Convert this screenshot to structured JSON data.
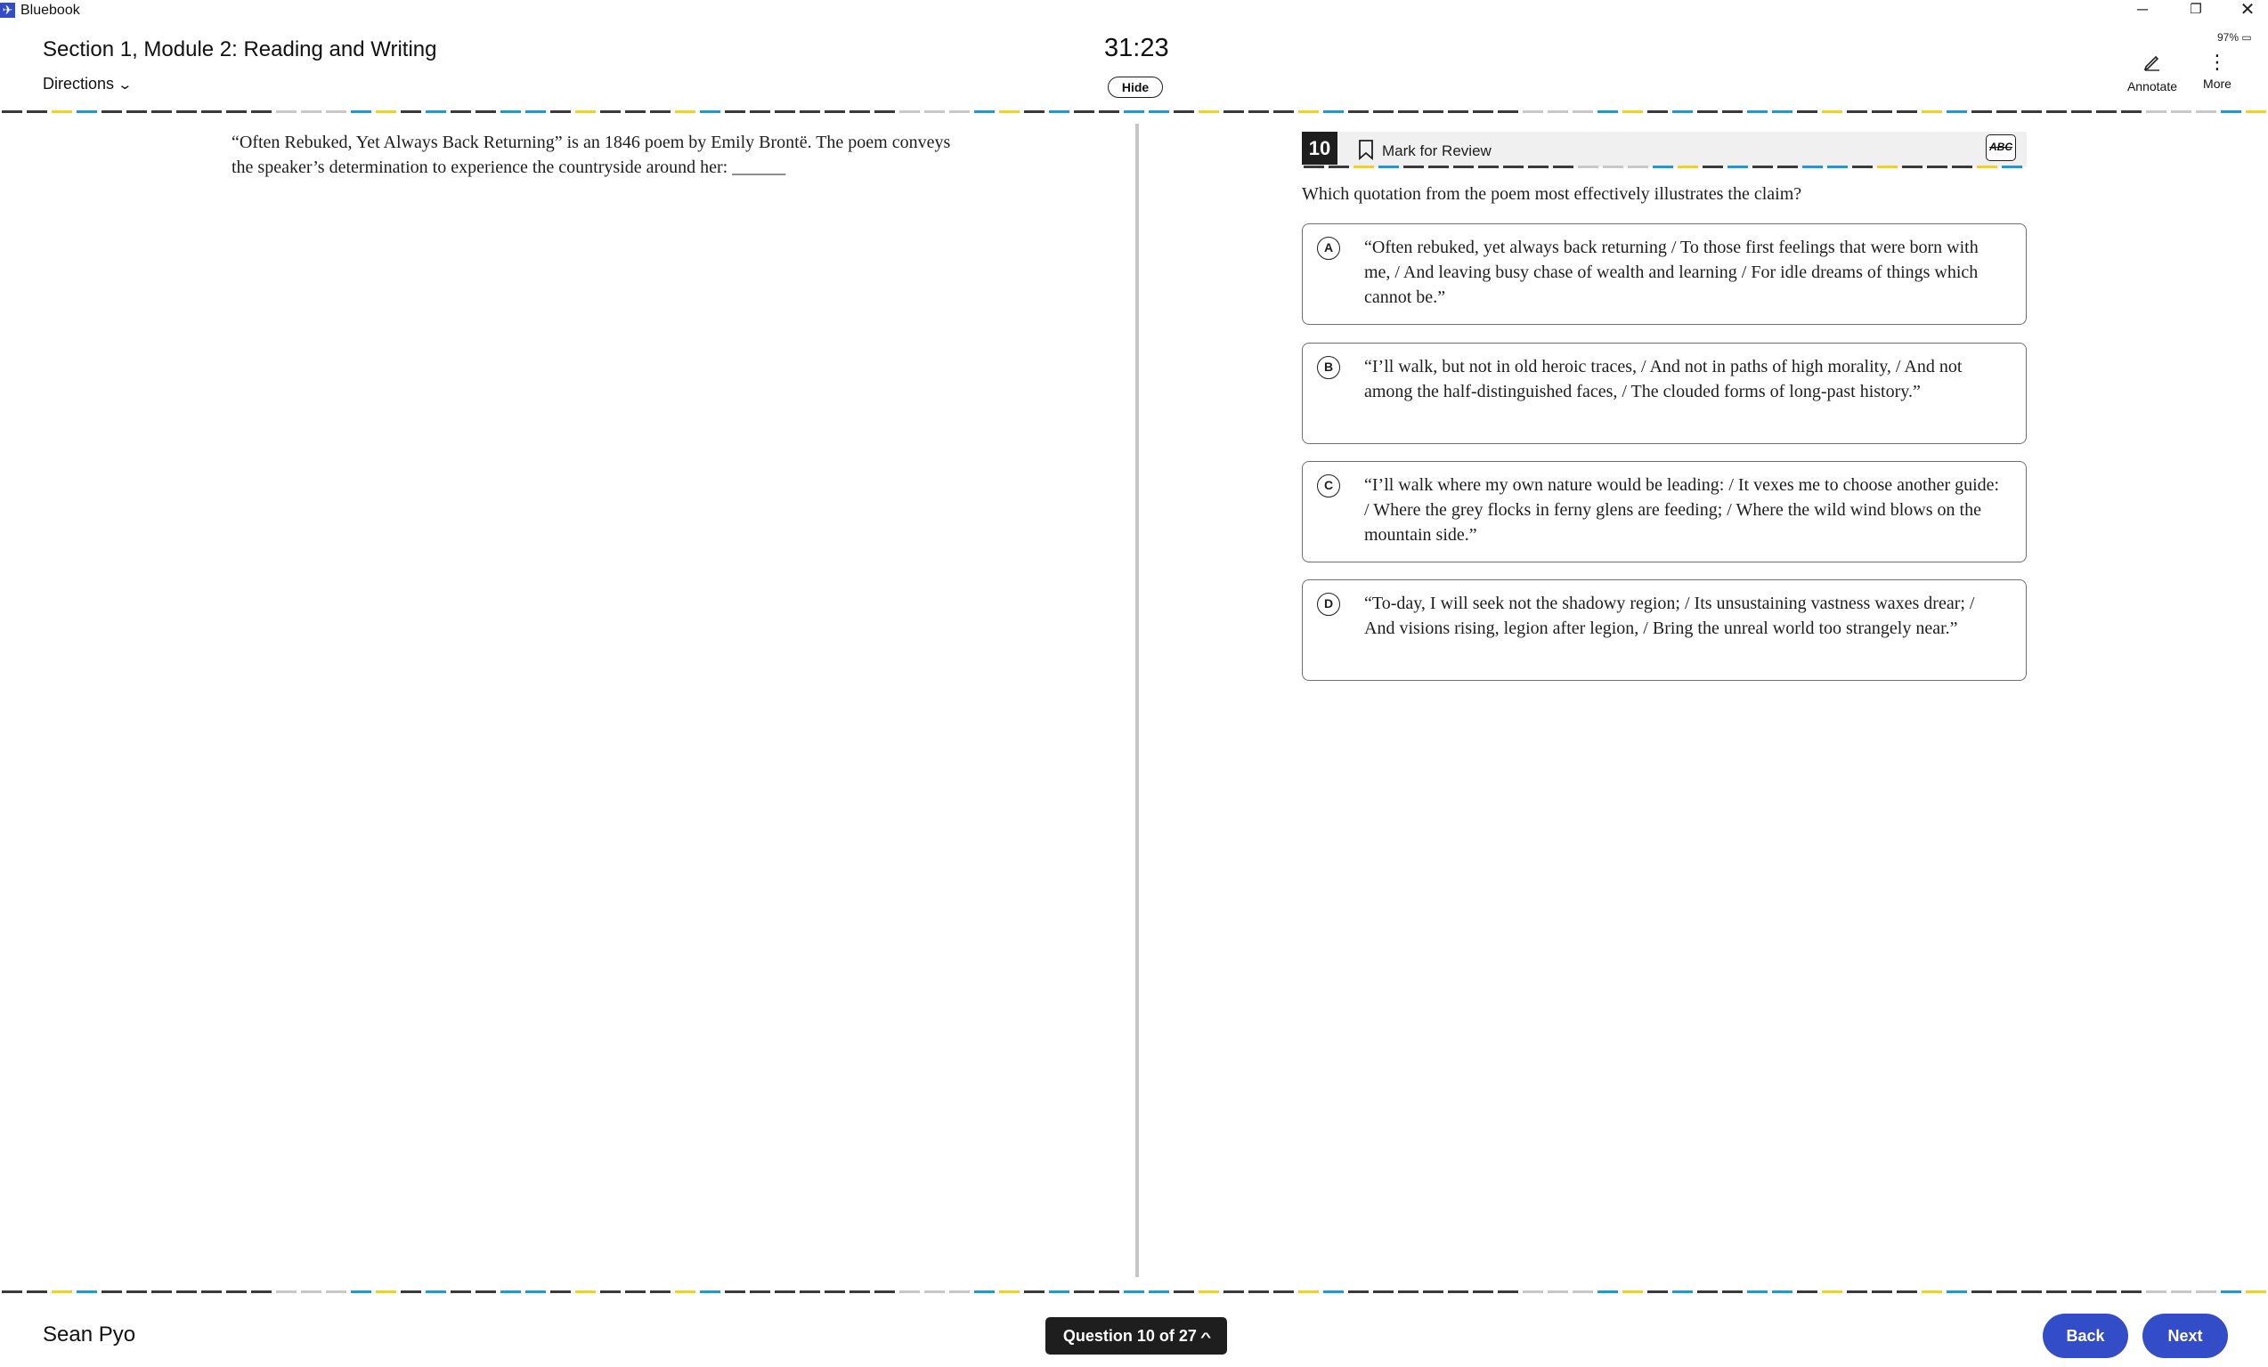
{
  "window": {
    "app_title": "Bluebook",
    "battery": "97%",
    "controls": {
      "minimize": "─",
      "restore": "❐",
      "close": "✕"
    }
  },
  "header": {
    "section_title": "Section 1, Module 2: Reading and Writing",
    "directions_label": "Directions",
    "timer": "31:23",
    "hide_label": "Hide",
    "tools": [
      {
        "label": "Annotate",
        "icon": "pencil-icon"
      },
      {
        "label": "More",
        "icon": "vertical-dots-icon"
      }
    ]
  },
  "passage": {
    "text": "“Often Rebuked, Yet Always Back Returning” is an 1846 poem by Emily Brontë. The poem conveys the speaker’s determination to experience the countryside around her: ______"
  },
  "question": {
    "number": "10",
    "mark_for_review": "Mark for Review",
    "abc_label": "ABC",
    "prompt": "Which quotation from the poem most effectively illustrates the claim?",
    "choices": [
      {
        "letter": "A",
        "text": "“Often rebuked, yet always back returning / To those first feelings that were born with me, / And leaving busy chase of wealth and learning / For idle dreams of things which cannot be.”"
      },
      {
        "letter": "B",
        "text": "“I’ll walk, but not in old heroic traces, / And not in paths of high morality, / And not among the half-distinguished faces, / The clouded forms of long-past history.”"
      },
      {
        "letter": "C",
        "text": "“I’ll walk where my own nature would be leading: / It vexes me to choose another guide: / Where the grey flocks in ferny glens are feeding; / Where the wild wind blows on the mountain side.”"
      },
      {
        "letter": "D",
        "text": "“To-day, I will seek not the shadowy region; / Its unsustaining vastness waxes drear; / And visions rising, legion after legion, / Bring the unreal world too strangely near.”"
      }
    ]
  },
  "footer": {
    "student_name": "Sean Pyo",
    "question_nav": "Question 10 of 27",
    "back_label": "Back",
    "next_label": "Next"
  },
  "colors": {
    "accent": "#324dc7",
    "dash_dark": "#3a3a3a",
    "dash_light": "#c8c8c8",
    "dash_yellow": "#f1d21d",
    "dash_blue": "#1b9ad6"
  }
}
